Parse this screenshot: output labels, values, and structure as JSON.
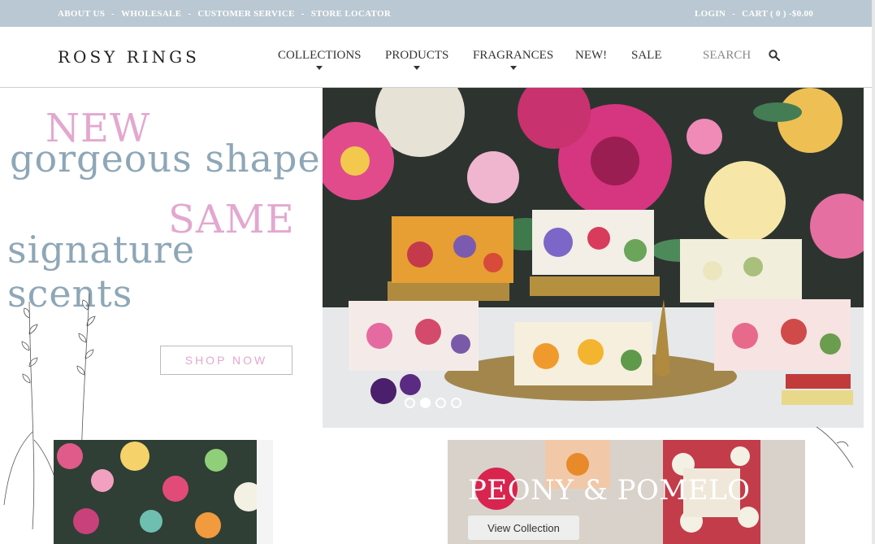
{
  "topbar": {
    "links_left": [
      "ABOUT US",
      "WHOLESALE",
      "CUSTOMER SERVICE",
      "STORE LOCATOR"
    ],
    "separator": "-",
    "login": "LOGIN",
    "cart": "CART ( 0 ) -$0.00"
  },
  "header": {
    "logo": "ROSY RINGS",
    "nav": [
      "COLLECTIONS",
      "PRODUCTS",
      "FRAGRANCES",
      "NEW!",
      "SALE"
    ],
    "search_placeholder": "SEARCH"
  },
  "hero": {
    "line1": "NEW",
    "line2": "gorgeous shape",
    "line3": "SAME",
    "line4": "signature scents",
    "cta": "SHOP NOW",
    "slides_total": 4,
    "slide_active": 1
  },
  "promo": {
    "title": "PEONY & POMELO",
    "cta": "View Collection"
  },
  "colors": {
    "topbar_bg": "#b9c8d2",
    "pink_accent": "#e3a8cf",
    "blue_gray_text": "#8ea7b7"
  }
}
